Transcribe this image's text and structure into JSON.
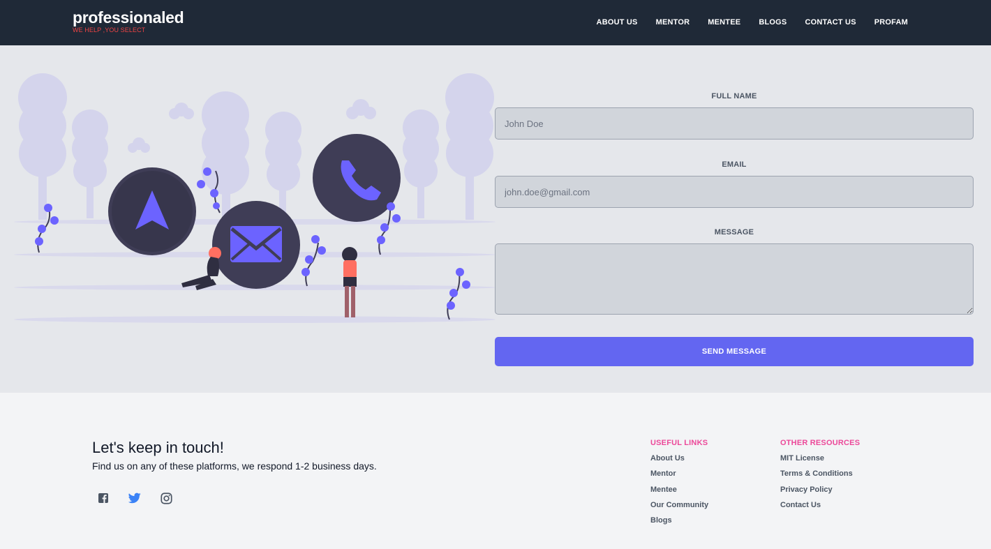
{
  "header": {
    "brand_name": "professionaled",
    "brand_tagline": "WE HELP ,YOU SELECT",
    "nav": [
      "ABOUT US",
      "MENTOR",
      "MENTEE",
      "BLOGS",
      "CONTACT US",
      "PROFAM"
    ]
  },
  "form": {
    "full_name_label": "FULL NAME",
    "full_name_placeholder": "John Doe",
    "email_label": "EMAIL",
    "email_placeholder": "john.doe@gmail.com",
    "message_label": "MESSAGE",
    "message_placeholder": "",
    "send_label": "SEND MESSAGE"
  },
  "footer": {
    "title": "Let's keep in touch!",
    "subtitle": "Find us on any of these platforms, we respond 1-2 business days.",
    "socials": [
      "facebook-icon",
      "twitter-icon",
      "instagram-icon"
    ],
    "useful_links_title": "USEFUL LINKS",
    "useful_links": [
      "About Us",
      "Mentor",
      "Mentee",
      "Our Community",
      "Blogs"
    ],
    "other_resources_title": "OTHER RESOURCES",
    "other_resources": [
      "MIT License",
      "Terms & Conditions",
      "Privacy Policy",
      "Contact Us"
    ]
  },
  "colors": {
    "header_bg": "#1f2937",
    "accent": "#6366f1",
    "brand_tag": "#ef4444",
    "footer_heading": "#ec4899",
    "twitter": "#3b82f6"
  }
}
